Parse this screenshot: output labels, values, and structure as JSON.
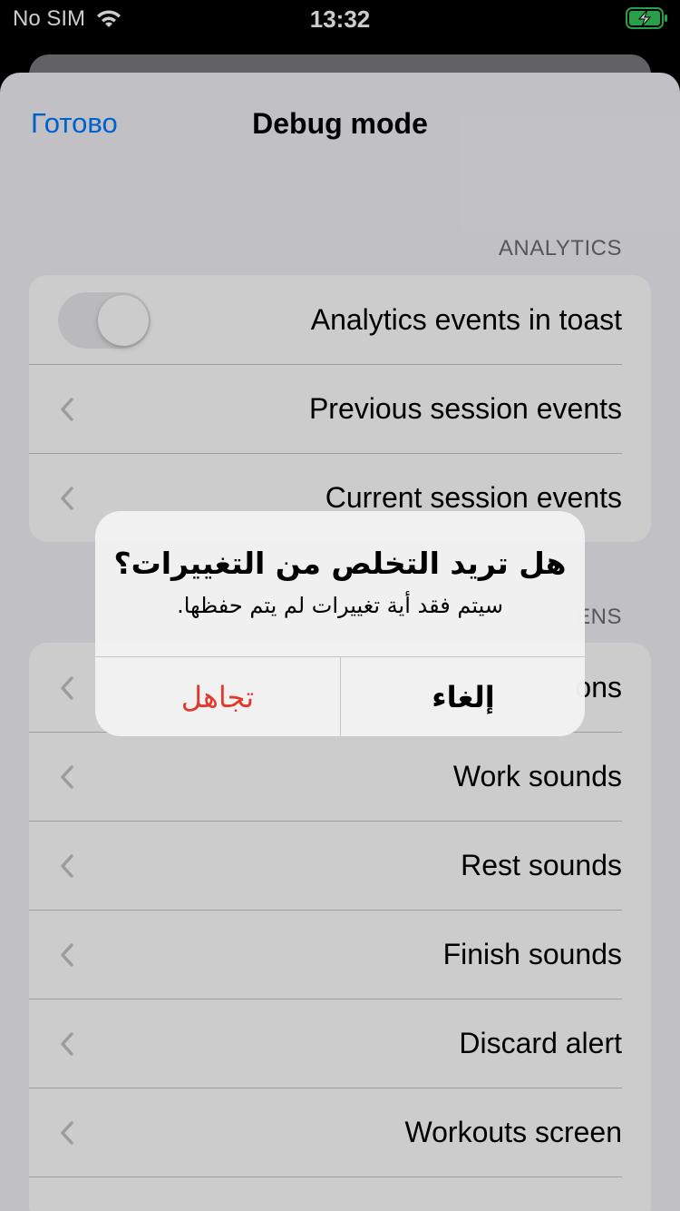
{
  "status_bar": {
    "carrier": "No SIM",
    "time": "13:32"
  },
  "nav": {
    "done_label": "Готово",
    "title": "Debug mode"
  },
  "analytics": {
    "header": "ANALYTICS",
    "toggle_label": "Analytics events in toast",
    "toggle_on": false,
    "rows": [
      "Previous session events",
      "Current session events"
    ]
  },
  "screens": {
    "header_visible": "ENS",
    "first_row_visible": "ons",
    "rows": [
      "Work sounds",
      "Rest sounds",
      "Finish sounds",
      "Discard alert",
      "Workouts screen"
    ]
  },
  "alert": {
    "title": "هل تريد التخلص من التغييرات؟",
    "message": "سيتم فقد أية تغييرات لم يتم حفظها.",
    "discard_label": "تجاهل",
    "cancel_label": "إلغاء"
  },
  "colors": {
    "accent": "#007aff",
    "destructive": "#e0392e",
    "background": "#f2f2f7",
    "battery_charging": "#34c759"
  }
}
